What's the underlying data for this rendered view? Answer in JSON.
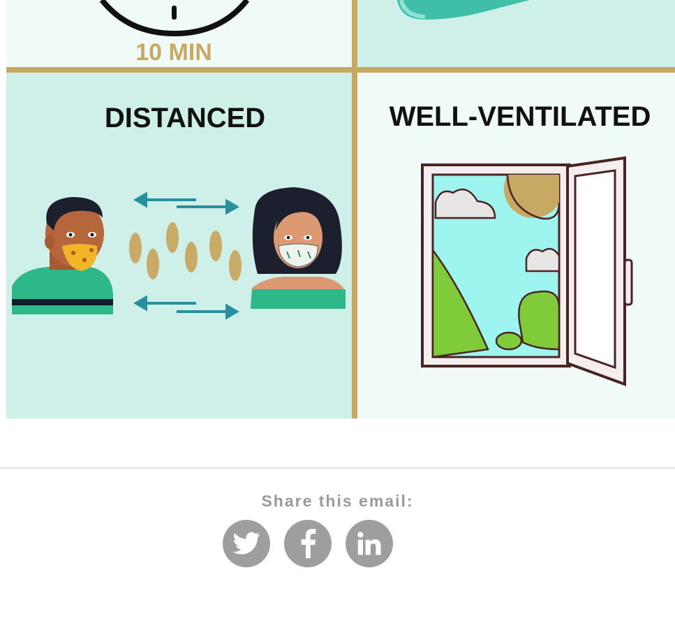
{
  "infographic": {
    "top_left_caption": "10 MIN",
    "panels": [
      {
        "heading": "DISTANCED"
      },
      {
        "heading": "WELL-VENTILATED"
      }
    ],
    "colors": {
      "mint_bg": "#cff0e8",
      "pale_bg": "#f0faf7",
      "gold_border": "#c8a964",
      "teal_arrow": "#2a8f9c",
      "footprint": "#c9ab67"
    }
  },
  "share": {
    "label": "Share this email:",
    "icons": [
      {
        "name": "twitter-icon"
      },
      {
        "name": "facebook-icon"
      },
      {
        "name": "linkedin-icon"
      }
    ],
    "icon_color": "#9e9e9e"
  }
}
